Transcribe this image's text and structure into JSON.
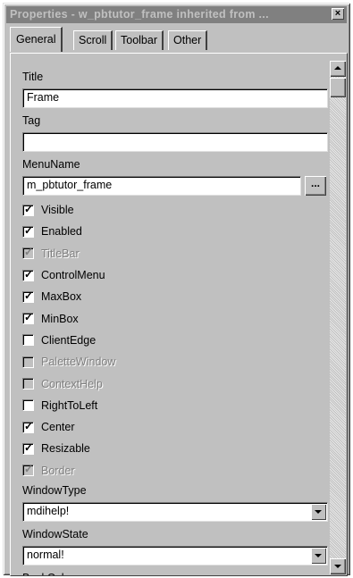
{
  "window": {
    "title": "Properties - w_pbtutor_frame inherited from ...",
    "close_glyph": "×"
  },
  "tabs": [
    {
      "label": "General",
      "active": true
    },
    {
      "label": "Scroll",
      "active": false
    },
    {
      "label": "Toolbar",
      "active": false
    },
    {
      "label": "Other",
      "active": false
    }
  ],
  "fields": {
    "title_label": "Title",
    "title_value": "Frame",
    "tag_label": "Tag",
    "tag_value": "",
    "menuname_label": "MenuName",
    "menuname_value": "m_pbtutor_frame",
    "browse_label": "..."
  },
  "checkboxes": [
    {
      "label": "Visible",
      "checked": true,
      "enabled": true
    },
    {
      "label": "Enabled",
      "checked": true,
      "enabled": true
    },
    {
      "label": "TitleBar",
      "checked": true,
      "enabled": false
    },
    {
      "label": "ControlMenu",
      "checked": true,
      "enabled": true
    },
    {
      "label": "MaxBox",
      "checked": true,
      "enabled": true
    },
    {
      "label": "MinBox",
      "checked": true,
      "enabled": true
    },
    {
      "label": "ClientEdge",
      "checked": false,
      "enabled": true
    },
    {
      "label": "PaletteWindow",
      "checked": false,
      "enabled": false
    },
    {
      "label": "ContextHelp",
      "checked": false,
      "enabled": false
    },
    {
      "label": "RightToLeft",
      "checked": false,
      "enabled": true
    },
    {
      "label": "Center",
      "checked": true,
      "enabled": true
    },
    {
      "label": "Resizable",
      "checked": true,
      "enabled": true
    },
    {
      "label": "Border",
      "checked": true,
      "enabled": false
    }
  ],
  "dropdowns": {
    "windowtype_label": "WindowType",
    "windowtype_value": "mdihelp!",
    "windowstate_label": "WindowState",
    "windowstate_value": "normal!",
    "backcolor_label": "BackColor"
  },
  "check_glyph": "✓",
  "colors": {
    "face": "#c0c0c0",
    "titlebar_inactive": "#808080",
    "field_bg": "#ffffff",
    "disabled_text": "#808080"
  }
}
